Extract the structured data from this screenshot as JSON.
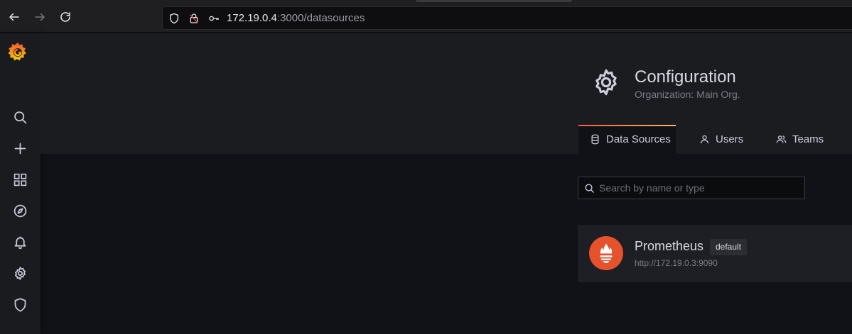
{
  "browser": {
    "url_host": "172.19.0.4",
    "url_path": ":3000/datasources",
    "icons": [
      "back-arrow-icon",
      "forward-arrow-icon",
      "reload-icon",
      "shield-icon",
      "lock-warning-icon",
      "key-icon"
    ]
  },
  "sidebar": {
    "logo": "grafana-logo",
    "items": [
      {
        "name": "search",
        "icon": "search-icon"
      },
      {
        "name": "create",
        "icon": "plus-icon"
      },
      {
        "name": "dashboards",
        "icon": "grid-icon"
      },
      {
        "name": "explore",
        "icon": "compass-icon"
      },
      {
        "name": "alerting",
        "icon": "bell-icon"
      },
      {
        "name": "configuration",
        "icon": "gear-icon"
      },
      {
        "name": "server-admin",
        "icon": "shield-icon"
      }
    ]
  },
  "header": {
    "title": "Configuration",
    "subtitle": "Organization: Main Org.",
    "tabs": [
      {
        "label": "Data Sources",
        "icon": "database-icon",
        "active": true
      },
      {
        "label": "Users",
        "icon": "user-icon",
        "active": false
      },
      {
        "label": "Teams",
        "icon": "users-icon",
        "active": false
      }
    ]
  },
  "search": {
    "placeholder": "Search by name or type",
    "value": ""
  },
  "datasources": [
    {
      "name": "Prometheus",
      "badge": "default",
      "url": "http://172.19.0.3:9090",
      "icon": "prometheus-logo"
    }
  ],
  "colors": {
    "accent_start": "#f55f3e",
    "accent_end": "#ffb357",
    "prometheus": "#e6522c"
  }
}
